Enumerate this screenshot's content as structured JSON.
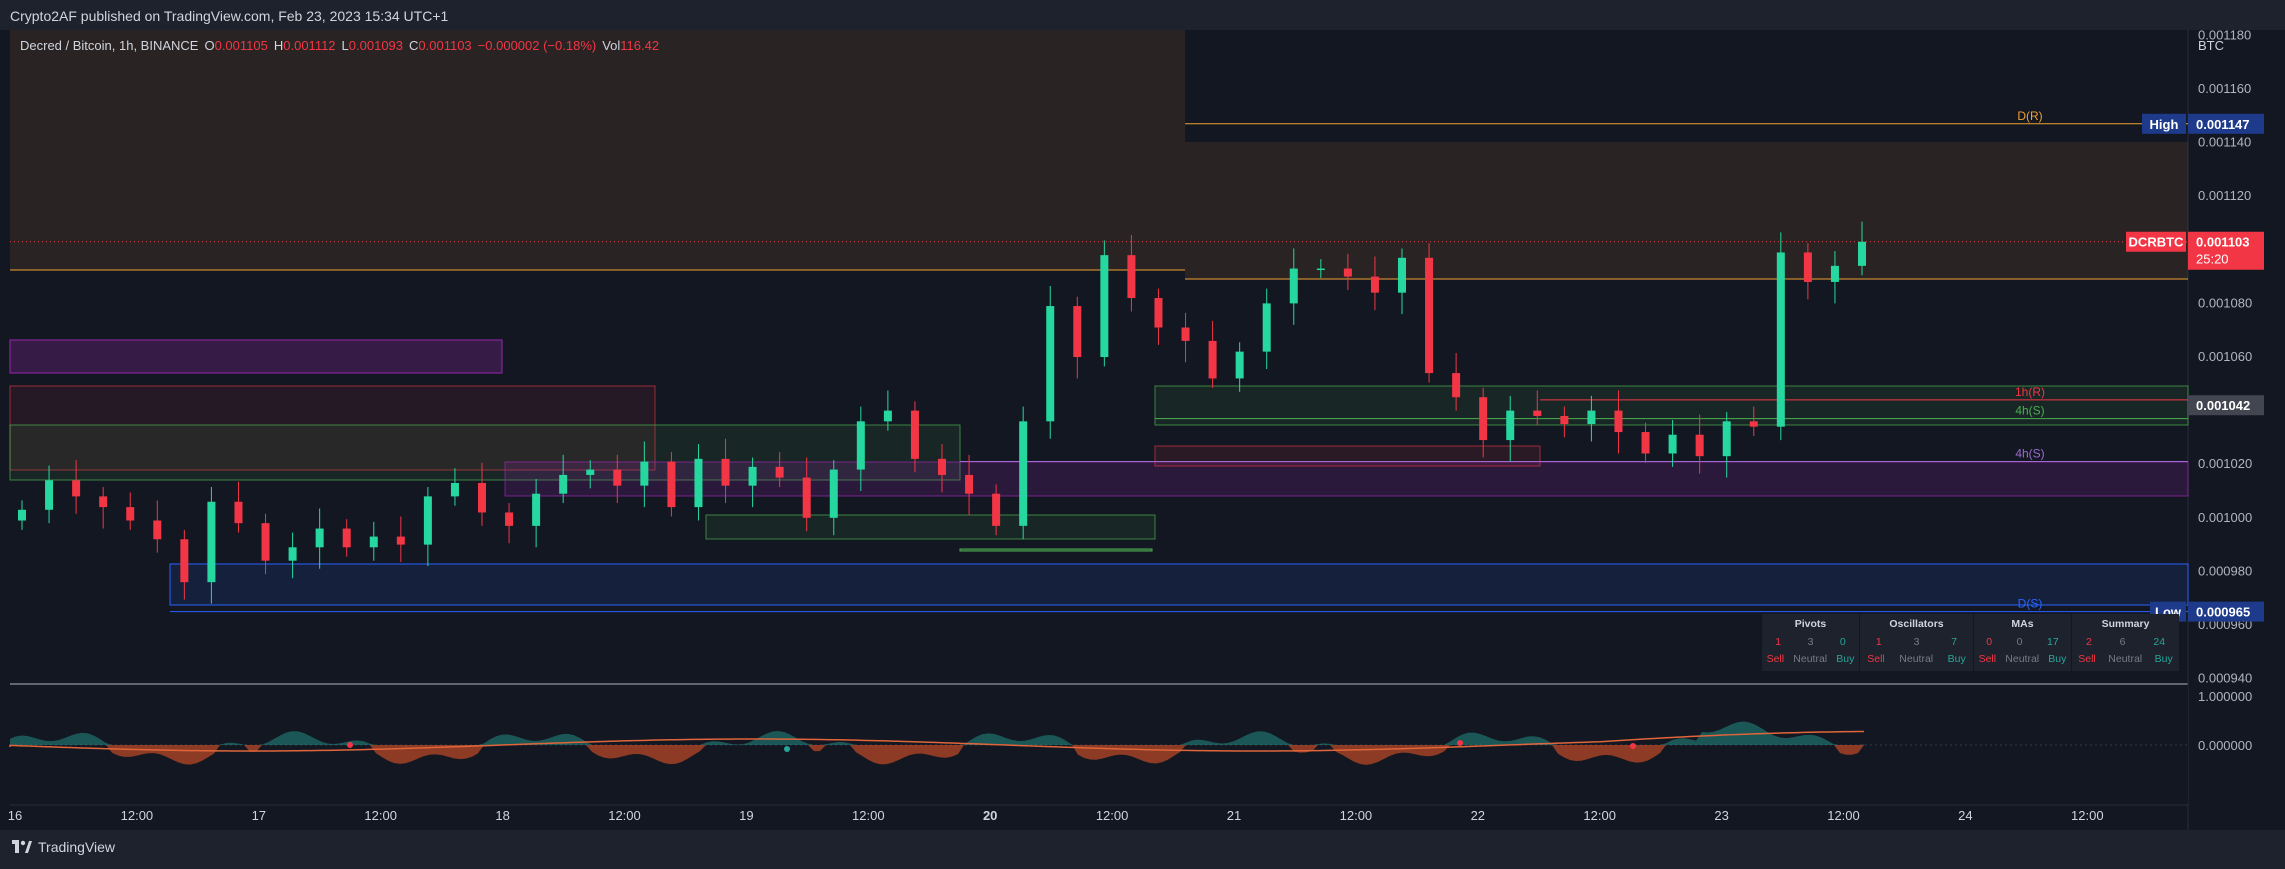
{
  "header": {
    "published": "Crypto2AF published on TradingView.com, Feb 23, 2023 15:34 UTC+1"
  },
  "legend": {
    "symbol": "Decred / Bitcoin, 1h, BINANCE",
    "o_label": "O",
    "o": "0.001105",
    "h_label": "H",
    "h": "0.001112",
    "l_label": "L",
    "l": "0.001093",
    "c_label": "C",
    "c": "0.001103",
    "change": "−0.000002 (−0.18%)",
    "vol_label": "Vol",
    "vol": "116.42"
  },
  "footer": {
    "brand": "TradingView"
  },
  "colors": {
    "up": "#26d8a0",
    "down": "#f23645",
    "bg": "#131722",
    "orange": "#f0a030",
    "purple": "#9c27b0",
    "blue": "#2962ff",
    "green": "#4caf50"
  },
  "chart_data": [
    {
      "type": "candlestick",
      "title": "Decred / Bitcoin, 1h, BINANCE",
      "ylabel": "BTC",
      "ylim": [
        0.000938,
        0.001182
      ],
      "y_ticks": [
        "0.001180",
        "0.001160",
        "0.001140",
        "0.001120",
        "0.001080",
        "0.001060",
        "0.001020",
        "0.001000",
        "0.000980",
        "0.000960",
        "0.000940"
      ],
      "x_ticks": [
        "16",
        "12:00",
        "17",
        "12:00",
        "18",
        "12:00",
        "19",
        "12:00",
        "20",
        "12:00",
        "21",
        "12:00",
        "22",
        "12:00",
        "23",
        "12:00",
        "24",
        "12:00"
      ],
      "price_labels": [
        {
          "tag": "High",
          "value": "0.001147"
        },
        {
          "tag": "DCRBTC",
          "value": "0.001103",
          "extra": "25:20"
        },
        {
          "tag": "",
          "value": "0.001042"
        },
        {
          "tag": "Low",
          "value": "0.000965"
        }
      ],
      "levels": [
        {
          "name": "D(R)",
          "value": 0.001147,
          "color": "#f0a030"
        },
        {
          "name": "1h(R)",
          "value": 0.001044,
          "color": "#f23645"
        },
        {
          "name": "4h(S)",
          "value": 0.001037,
          "color": "#4caf50"
        },
        {
          "name": "4h(S)",
          "value": 0.001021,
          "color": "#9c6bd0"
        },
        {
          "name": "D(S)",
          "value": 0.000965,
          "color": "#2962ff"
        }
      ],
      "candles_close_approx": [
        0.001003,
        0.001014,
        0.001008,
        0.001004,
        0.000999,
        0.000992,
        0.000976,
        0.001006,
        0.000998,
        0.000984,
        0.000989,
        0.000996,
        0.000989,
        0.000993,
        0.00099,
        0.001008,
        0.001013,
        0.001002,
        0.000997,
        0.001009,
        0.001016,
        0.001018,
        0.001012,
        0.001021,
        0.001004,
        0.001022,
        0.001012,
        0.001019,
        0.001015,
        0.001,
        0.001018,
        0.001036,
        0.00104,
        0.001022,
        0.001016,
        0.001009,
        0.000997,
        0.001036,
        0.001079,
        0.00106,
        0.001098,
        0.001082,
        0.001071,
        0.001066,
        0.001052,
        0.001062,
        0.00108,
        0.001093,
        0.001093,
        0.00109,
        0.001084,
        0.001097,
        0.001054,
        0.001045,
        0.001029,
        0.00104,
        0.001038,
        0.001035,
        0.00104,
        0.001032,
        0.001024,
        0.001031,
        0.001023,
        0.001036,
        0.001034,
        0.001099,
        0.001088,
        0.001094,
        0.001103
      ]
    },
    {
      "type": "table",
      "title": "",
      "columns": [
        "Pivots",
        "Oscillators",
        "MAs",
        "Summary"
      ],
      "rows": [
        {
          "sell": "1",
          "neutral": "3",
          "buy": "0"
        },
        {
          "sell": "1",
          "neutral": "3",
          "buy": "7"
        },
        {
          "sell": "0",
          "neutral": "0",
          "buy": "17"
        },
        {
          "sell": "2",
          "neutral": "6",
          "buy": "24"
        }
      ],
      "labels": {
        "sell": "Sell",
        "neutral": "Neutral",
        "buy": "Buy"
      }
    },
    {
      "type": "area",
      "title": "",
      "y_ticks": [
        "1.000000",
        "0.000000"
      ]
    }
  ]
}
